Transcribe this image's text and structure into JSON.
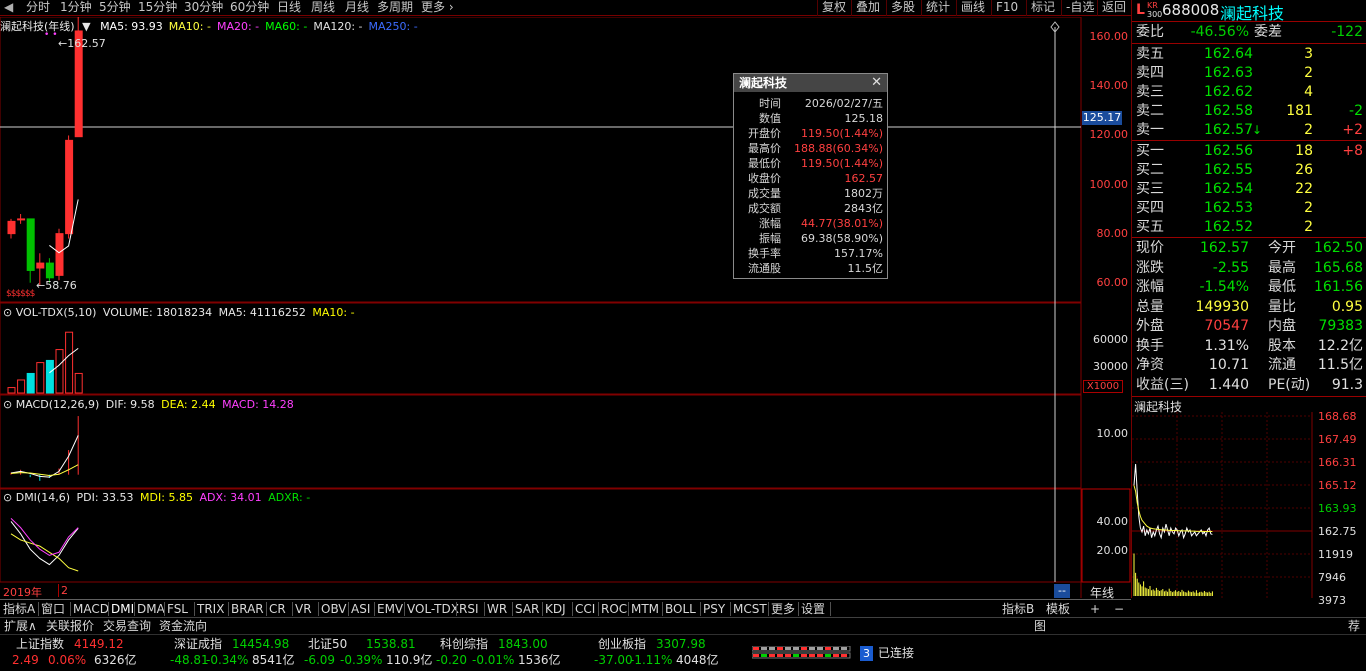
{
  "toolbar": {
    "periods": [
      "分时",
      "1分钟",
      "5分钟",
      "15分钟",
      "30分钟",
      "60分钟",
      "日线",
      "周线",
      "月线",
      "多周期"
    ],
    "more": "更多",
    "right_buttons": [
      "复权",
      "叠加",
      "多股",
      "统计",
      "画线",
      "F10",
      "标记",
      "-自选",
      "返回"
    ]
  },
  "main_panel": {
    "title": "澜起科技(年线)",
    "ma": [
      {
        "label": "MA5: 93.93",
        "color": "#ffffff"
      },
      {
        "label": "MA10: -",
        "color": "#ffff40"
      },
      {
        "label": "MA20: -",
        "color": "#ff40ff"
      },
      {
        "label": "MA60: -",
        "color": "#00ff00"
      },
      {
        "label": "MA120: -",
        "color": "#e0e0e0"
      },
      {
        "label": "MA250: -",
        "color": "#3c6cff"
      }
    ],
    "high_marker": "162.57",
    "low_marker": "58.76",
    "crosshair_value": "125.17",
    "y_labels": [
      "160.00",
      "140.00",
      "120.00",
      "100.00",
      "80.00",
      "60.00"
    ],
    "y_values": [
      160,
      140,
      120,
      100,
      80,
      60
    ],
    "dollar_marks": "$$$$$$"
  },
  "volume_panel": {
    "title": "VOL-TDX(5,10)",
    "volume": "VOLUME: 18018234",
    "ma5": "MA5: 41116252",
    "ma10": "MA10: -",
    "y_labels": [
      "60000",
      "30000"
    ],
    "unit": "X1000"
  },
  "macd_panel": {
    "title": "MACD(12,26,9)",
    "dif": "DIF: 9.58",
    "dea": "DEA: 2.44",
    "macd": "MACD: 14.28",
    "y_labels": [
      "10.00"
    ]
  },
  "dmi_panel": {
    "title": "DMI(14,6)",
    "pdi": "PDI: 33.53",
    "mdi": "MDI: 5.85",
    "adx": "ADX: 34.01",
    "adxr": "ADXR: -",
    "y_labels": [
      "40.00",
      "20.00"
    ]
  },
  "x_axis": {
    "start": "2019年",
    "mark": "2",
    "period_label": "年线",
    "corner": "--"
  },
  "tooltip": {
    "title": "澜起科技",
    "rows": [
      {
        "k": "时间",
        "v": "2026/02/27/五",
        "color": "#d8d8d8"
      },
      {
        "k": "数值",
        "v": "125.18",
        "color": "#d8d8d8"
      },
      {
        "k": "开盘价",
        "v": "119.50(1.44%)",
        "color": "#ff4040"
      },
      {
        "k": "最高价",
        "v": "188.88(60.34%)",
        "color": "#ff4040"
      },
      {
        "k": "最低价",
        "v": "119.50(1.44%)",
        "color": "#ff4040"
      },
      {
        "k": "收盘价",
        "v": "162.57",
        "color": "#ff4040"
      },
      {
        "k": "成交量",
        "v": "1802万",
        "color": "#d8d8d8"
      },
      {
        "k": "成交额",
        "v": "2843亿",
        "color": "#d8d8d8"
      },
      {
        "k": "涨幅",
        "v": "44.77(38.01%)",
        "color": "#ff4040"
      },
      {
        "k": "振幅",
        "v": "69.38(58.90%)",
        "color": "#d8d8d8"
      },
      {
        "k": "换手率",
        "v": "157.17%",
        "color": "#d8d8d8"
      },
      {
        "k": "流通股",
        "v": "11.5亿",
        "color": "#d8d8d8"
      }
    ]
  },
  "tabs_indicators": [
    "指标A",
    "窗口",
    "MACD",
    "DMI",
    "DMA",
    "FSL",
    "TRIX",
    "BRAR",
    "CR",
    "VR",
    "OBV",
    "ASI",
    "EMV",
    "VOL-TDX",
    "RSI",
    "WR",
    "SAR",
    "KDJ",
    "CCI",
    "ROC",
    "MTM",
    "BOLL",
    "PSY",
    "MCST",
    "更多",
    "设置"
  ],
  "tabs_right": [
    "指标B",
    "模板",
    "+",
    "−"
  ],
  "tabs_secondary": [
    "扩展∧",
    "关联报价",
    "交易查询",
    "资金流向"
  ],
  "tabs_secondary_right": [
    "图",
    "荐"
  ],
  "indexes": [
    {
      "name": "上证指数",
      "value": "4149.12",
      "change": "2.49",
      "pct": "0.06%",
      "amount": "6326亿",
      "up": true
    },
    {
      "name": "深证成指",
      "value": "14454.98",
      "change": "-48.81",
      "pct": "-0.34%",
      "amount": "8541亿",
      "up": false
    },
    {
      "name": "北证50",
      "value": "1538.81",
      "change": "-6.09",
      "pct": "-0.39%",
      "amount": "110.9亿",
      "up": false
    },
    {
      "name": "科创综指",
      "value": "1843.00",
      "change": "-0.20",
      "pct": "-0.01%",
      "amount": "1536亿",
      "up": false
    },
    {
      "name": "创业板指",
      "value": "3307.98",
      "change": "-37.00",
      "pct": "-1.11%",
      "amount": "4048亿",
      "up": false
    }
  ],
  "connection": {
    "count": "3",
    "label": "已连接"
  },
  "quote": {
    "badge_l": "L",
    "badge_kr": "KR",
    "badge_300": "300",
    "code": "688008",
    "name": "澜起科技",
    "weibi_label": "委比",
    "weibi": "-46.56%",
    "weicha_label": "委差",
    "weicha": "-122",
    "sells": [
      {
        "label": "卖五",
        "price": "162.64",
        "vol": "3",
        "chg": ""
      },
      {
        "label": "卖四",
        "price": "162.63",
        "vol": "2",
        "chg": ""
      },
      {
        "label": "卖三",
        "price": "162.62",
        "vol": "4",
        "chg": ""
      },
      {
        "label": "卖二",
        "price": "162.58",
        "vol": "181",
        "chg": "-2"
      },
      {
        "label": "卖一",
        "price": "162.57",
        "vol": "2",
        "chg": "+2",
        "arrow": "↓"
      }
    ],
    "buys": [
      {
        "label": "买一",
        "price": "162.56",
        "vol": "18",
        "chg": "+8"
      },
      {
        "label": "买二",
        "price": "162.55",
        "vol": "26",
        "chg": ""
      },
      {
        "label": "买三",
        "price": "162.54",
        "vol": "22",
        "chg": ""
      },
      {
        "label": "买四",
        "price": "162.53",
        "vol": "2",
        "chg": ""
      },
      {
        "label": "买五",
        "price": "162.52",
        "vol": "2",
        "chg": ""
      }
    ],
    "stats": [
      {
        "k1": "现价",
        "v1": "162.57",
        "c1": "#00e000",
        "k2": "今开",
        "v2": "162.50",
        "c2": "#00e000"
      },
      {
        "k1": "涨跌",
        "v1": "-2.55",
        "c1": "#00e000",
        "k2": "最高",
        "v2": "165.68",
        "c2": "#00e000"
      },
      {
        "k1": "涨幅",
        "v1": "-1.54%",
        "c1": "#00e000",
        "k2": "最低",
        "v2": "161.56",
        "c2": "#00e000"
      },
      {
        "k1": "总量",
        "v1": "149930",
        "c1": "#ffff40",
        "k2": "量比",
        "v2": "0.95",
        "c2": "#ffff40"
      },
      {
        "k1": "外盘",
        "v1": "70547",
        "c1": "#ff4040",
        "k2": "内盘",
        "v2": "79383",
        "c2": "#00e000"
      },
      {
        "k1": "换手",
        "v1": "1.31%",
        "c1": "#e0e0e0",
        "k2": "股本",
        "v2": "12.2亿",
        "c2": "#e0e0e0"
      },
      {
        "k1": "净资",
        "v1": "10.71",
        "c1": "#e0e0e0",
        "k2": "流通",
        "v2": "11.5亿",
        "c2": "#e0e0e0"
      },
      {
        "k1": "收益(三)",
        "v1": "1.440",
        "c1": "#e0e0e0",
        "k2": "PE(动)",
        "v2": "91.3",
        "c2": "#e0e0e0"
      }
    ]
  },
  "mini_chart": {
    "title": "澜起科技",
    "y_labels": [
      "168.68",
      "167.49",
      "166.31",
      "165.12",
      "163.93",
      "162.75",
      "11919",
      "7946",
      "3973"
    ]
  },
  "chart_data": {
    "type": "candlestick",
    "period": "yearly",
    "x": [
      "2019",
      "2020",
      "2021",
      "2022",
      "2023",
      "2024",
      "2025",
      "2026"
    ],
    "candles": [
      {
        "o": 80,
        "h": 86,
        "l": 78,
        "c": 85,
        "up": true
      },
      {
        "o": 86,
        "h": 88,
        "l": 84,
        "c": 86,
        "up": true
      },
      {
        "o": 86,
        "h": 86,
        "l": 60,
        "c": 65,
        "up": false
      },
      {
        "o": 66,
        "h": 72,
        "l": 58.76,
        "c": 68,
        "up": true
      },
      {
        "o": 68,
        "h": 70,
        "l": 60,
        "c": 62,
        "up": false
      },
      {
        "o": 63,
        "h": 82,
        "l": 61,
        "c": 80,
        "up": true
      },
      {
        "o": 80,
        "h": 120,
        "l": 78,
        "c": 118,
        "up": true
      },
      {
        "o": 119.5,
        "h": 188.88,
        "l": 119.5,
        "c": 162.57,
        "up": true
      }
    ],
    "ma5": [
      null,
      null,
      null,
      null,
      75.2,
      72.2,
      75,
      93.93
    ],
    "volume_bars": [
      5000,
      12000,
      18000,
      28000,
      30000,
      40000,
      56000,
      18018
    ],
    "volume_ma": [
      null,
      null,
      null,
      null,
      18600,
      25600,
      34400,
      41116
    ],
    "macd_hist": [
      0.5,
      1.2,
      -0.6,
      -1.5,
      -0.8,
      1.5,
      6.0,
      14.28
    ],
    "dif": [
      0.4,
      0.8,
      0.3,
      -0.4,
      -0.6,
      0.8,
      4.5,
      9.58
    ],
    "dea": [
      0.3,
      0.5,
      0.4,
      0.1,
      -0.2,
      0.1,
      1.2,
      2.44
    ],
    "pdi": [
      38,
      30,
      20,
      14,
      10,
      16,
      26,
      33.53
    ],
    "mdi": [
      30,
      26,
      24,
      22,
      18,
      14,
      8,
      5.85
    ],
    "adx": [
      40,
      34,
      26,
      20,
      16,
      18,
      28,
      34.01
    ],
    "ylim_main": [
      55,
      165
    ],
    "ylim_vol": [
      0,
      70000
    ],
    "ylim_macd": [
      -3,
      16
    ],
    "ylim_dmi": [
      0,
      50
    ],
    "intraday_price": [
      165.1,
      166.2,
      164.8,
      163.5,
      162.9,
      162.7,
      163.0,
      162.5,
      162.8,
      162.6,
      162.9,
      162.4,
      162.7,
      162.5,
      162.8,
      163.0,
      162.6,
      162.4,
      162.9,
      162.7,
      163.1,
      162.8,
      162.5,
      162.9,
      162.7,
      162.6,
      162.9,
      162.8,
      162.5,
      162.7,
      162.8,
      162.4,
      162.6,
      162.9,
      162.7,
      162.8,
      162.5,
      162.6,
      162.7,
      162.5,
      162.6,
      162.7,
      162.8,
      162.6,
      162.7,
      162.5,
      162.8,
      162.9,
      162.6,
      162.57
    ],
    "intraday_avg": [
      165.1,
      164.8,
      164.2,
      163.8,
      163.5,
      163.3,
      163.2,
      163.1,
      163.0,
      162.95,
      162.9,
      162.88,
      162.86,
      162.85,
      162.84,
      162.83,
      162.82,
      162.81,
      162.8,
      162.8,
      162.8,
      162.79,
      162.78,
      162.78,
      162.77,
      162.77,
      162.77,
      162.76,
      162.76,
      162.76,
      162.75,
      162.75,
      162.75,
      162.75,
      162.75,
      162.74,
      162.74,
      162.74,
      162.74,
      162.73,
      162.73,
      162.73,
      162.73,
      162.73,
      162.72,
      162.72,
      162.72,
      162.72,
      162.72,
      162.72
    ],
    "intraday_vol": [
      11000,
      6000,
      4500,
      3500,
      3000,
      2500,
      3800,
      2200,
      2000,
      1800,
      2600,
      1500,
      1700,
      1400,
      2100,
      1600,
      1300,
      1500,
      1800,
      1200,
      1400,
      1100,
      1900,
      1300,
      1000,
      1200,
      1500,
      1100,
      1300,
      1000,
      1600,
      1200,
      1000,
      900,
      1400,
      1100,
      1000,
      1200,
      900,
      1500,
      800,
      1000,
      1100,
      900,
      1300,
      1000,
      900,
      1100,
      800,
      1200
    ],
    "intraday_ylim": [
      161.56,
      168.68
    ],
    "intraday_vol_max": 11919
  }
}
